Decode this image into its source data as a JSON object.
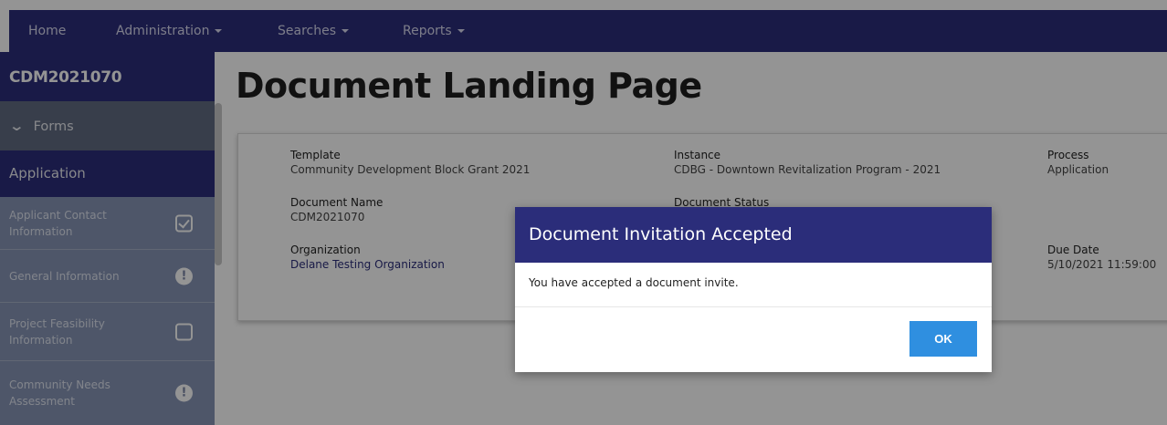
{
  "nav": {
    "home": "Home",
    "administration": "Administration",
    "searches": "Searches",
    "reports": "Reports"
  },
  "sidebar": {
    "header": "CDM2021070",
    "forms_label": "Forms",
    "application_label": "Application",
    "items": [
      {
        "label": "Applicant Contact Information",
        "icon": "checked-box-icon"
      },
      {
        "label": "General Information",
        "icon": "exclamation-circle-icon"
      },
      {
        "label": "Project Feasibility Information",
        "icon": "empty-box-icon"
      },
      {
        "label": "Community Needs Assessment",
        "icon": "exclamation-circle-icon"
      }
    ]
  },
  "main": {
    "title": "Document Landing Page",
    "fields": {
      "template_label": "Template",
      "template_value": "Community Development Block Grant 2021",
      "instance_label": "Instance",
      "instance_value": "CDBG - Downtown Revitalization Program - 2021",
      "process_label": "Process",
      "process_value": "Application",
      "doc_name_label": "Document Name",
      "doc_name_value": "CDM2021070",
      "doc_status_label": "Document Status",
      "org_label": "Organization",
      "org_value": "Delane Testing Organization",
      "due_date_label": "Due Date",
      "due_date_value": "5/10/2021 11:59:00"
    }
  },
  "modal": {
    "title": "Document Invitation Accepted",
    "body": "You have accepted a document invite.",
    "ok": "OK"
  },
  "colors": {
    "brand": "#2b2d7a",
    "button": "#2f8fe0",
    "sidebar": "#8795b6"
  }
}
